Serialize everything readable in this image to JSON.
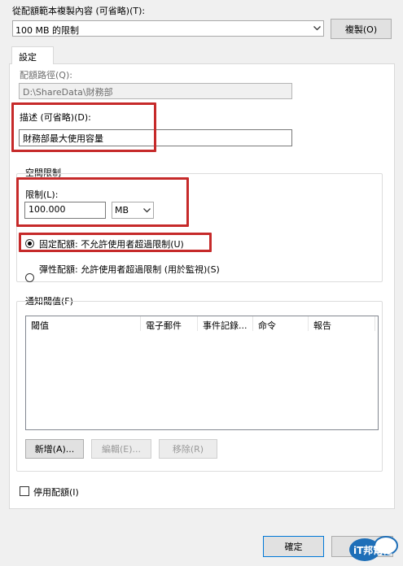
{
  "template": {
    "label": "從配額範本複製內容 (可省略)(T):",
    "selected": "100 MB 的限制",
    "copy_button": "複製(O)"
  },
  "tab": {
    "label": "設定"
  },
  "quota_path": {
    "label": "配額路徑(Q):",
    "value": "D:\\ShareData\\財務部"
  },
  "description": {
    "label": "描述 (可省略)(D):",
    "value": "財務部最大使用容量"
  },
  "space_limit": {
    "group_label": "空間限制",
    "limit_label": "限制(L):",
    "limit_value": "100.000",
    "unit": "MB",
    "hard_quota_label": "固定配額: 不允許使用者超過限制(U)",
    "soft_quota_label": "彈性配額: 允許使用者超過限制 (用於監視)(S)",
    "selected_option": "hard"
  },
  "notification": {
    "group_label": "通知閾值(F)",
    "columns": [
      "閾值",
      "電子郵件",
      "事件記錄...",
      "命令",
      "報告"
    ],
    "rows": [],
    "add_button": "新增(A)...",
    "edit_button": "編輯(E)...",
    "remove_button": "移除(R)"
  },
  "disable_quota": {
    "label": "停用配額(I)",
    "checked": false
  },
  "footer": {
    "ok_button": "確定",
    "cancel_button": "取",
    "watermark_text": "iT邦幫忙"
  },
  "colors": {
    "highlight_border": "#c62a2a",
    "primary_border": "#0078d7",
    "background": "#f0f0f0"
  }
}
